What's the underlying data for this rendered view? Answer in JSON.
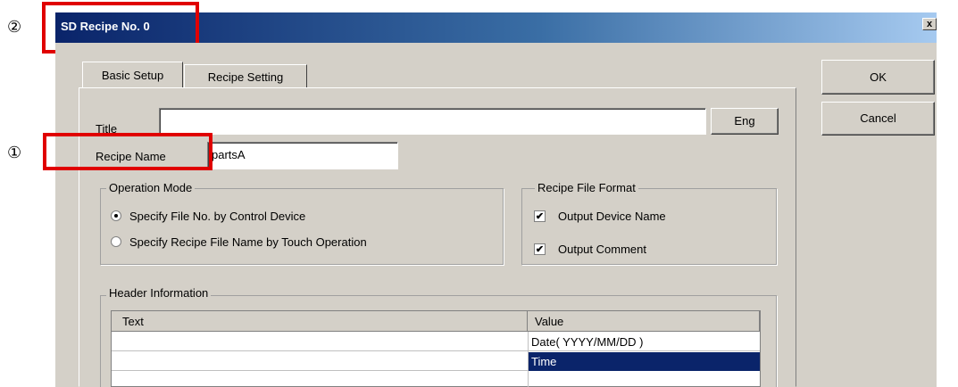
{
  "callouts": {
    "one": "①",
    "two": "②"
  },
  "window": {
    "title": "SD Recipe No. 0",
    "close_glyph": "x"
  },
  "tabs": [
    {
      "label": "Basic Setup"
    },
    {
      "label": "Recipe Setting"
    }
  ],
  "buttons": {
    "ok": "OK",
    "cancel": "Cancel",
    "eng": "Eng"
  },
  "fields": {
    "title_label": "Title",
    "title_value": "",
    "recipe_name_label": "Recipe Name",
    "recipe_name_value": "partsA"
  },
  "operation_mode": {
    "legend": "Operation Mode",
    "options": [
      {
        "label": "Specify File No. by Control Device",
        "selected": true
      },
      {
        "label": "Specify Recipe File Name by Touch Operation",
        "selected": false
      }
    ]
  },
  "recipe_file_format": {
    "legend": "Recipe File Format",
    "options": [
      {
        "label": "Output Device Name",
        "checked": true
      },
      {
        "label": "Output Comment",
        "checked": true
      }
    ]
  },
  "header_info": {
    "legend": "Header Information",
    "columns": [
      "Text",
      "Value"
    ],
    "rows": [
      {
        "text": "",
        "value": "Date( YYYY/MM/DD )"
      },
      {
        "text": "",
        "value": "Time"
      }
    ]
  },
  "colors": {
    "title_start": "#0a246a",
    "title_end": "#a6caf0",
    "highlight": "#e00000",
    "selection": "#0a246a",
    "dialog_bg": "#d4d0c8"
  },
  "icons": {
    "check": "✔"
  }
}
